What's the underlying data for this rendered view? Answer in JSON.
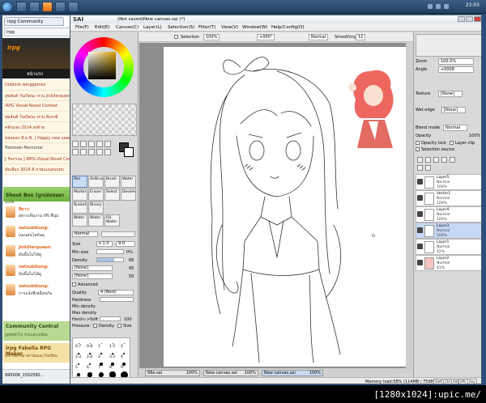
{
  "taskbar": {
    "clock": "23:03"
  },
  "browser": {
    "tab_title": "irpg Community",
    "address": "irpg",
    "logo": "irpg",
    "nav_home": "หน้าแรก",
    "news": [
      "Unblock winggames",
      "สุขสันต์ วันเกิดนะ ท่าน jinkilerqueen",
      "iRPG Visual Novel Contest",
      "สุขสันต์ วันเกิดนะ ท่าน ดีเอกซ์",
      "คลิปแข่ง 2014 ส่งท้าย",
      "หล่อตลก B.o.N. | Happy new year",
      "Tokimeki Memorial",
      "[ กิจกรรม ] iRPG Visual Novel Contest",
      "คัดเลือก 2014 สิ ภาพแบบลบบทบ"
    ],
    "shoutbox_title": "Shout Box (ถูกปล่อยออกมา)",
    "shouts": [
      {
        "name": "สีขาว:",
        "text": "อยากเห็นงาน VN ที่นุ่ม"
      },
      {
        "name": "natsukikung:",
        "text": "เนเนฮนไลจันดุ"
      },
      {
        "name": "jinkillerqueen:",
        "text": "อันนี้นไม่ได้ดู"
      },
      {
        "name": "natsukikung:",
        "text": "อันนี้นไม่ได้ดู"
      },
      {
        "name": "natsukikung:",
        "text": "การแจ้งที่เหมือนกับ"
      }
    ],
    "community_title": "Community Central",
    "community_sub": "พูดคุยทั่วไป ร่วมแลกเปลี่ยน",
    "fabella_title": "irpg Fabella RPG Maker",
    "fabella_sub": "มหาวิทยาลัย สถาบันและโรงเรียน",
    "download": "995006_1502582..."
  },
  "sai": {
    "logo": "SAI",
    "doc_title": "(Not saved)New canvas.sai (*)",
    "menus": [
      "File(F)",
      "Edit(E)",
      "Canvas(C)",
      "Layer(L)",
      "Selection(S)",
      "Filter(T)",
      "View(V)",
      "Window(W)",
      "Help/Config(O)"
    ],
    "options": {
      "selection_label": "Selection",
      "zoom": "100%",
      "angle": "+000°",
      "blend": "Normal",
      "smoothing_label": "Smoothing",
      "smoothing_value": "12"
    },
    "tools": [
      "Pen",
      "AirBrush",
      "Brush",
      "Water",
      "Marker",
      "Eraser",
      "Select",
      "Deselect",
      "Bucket",
      "Binary",
      "Water",
      "Water",
      "Oil Water"
    ],
    "brush": {
      "mode": "Normal",
      "size_label": "Size",
      "size_mult": "x 1.0",
      "size_value": "9.0",
      "minsize_label": "Min size",
      "minsize_value": "0%",
      "density_label": "Density",
      "density_value": "66",
      "texture": "[None]",
      "texture_value": "95",
      "shape": "[None]",
      "shape_value": "50",
      "advanced": "Advanced",
      "quality_label": "Quality",
      "quality_value": "4 (Best)",
      "hardness_label": "Hardness",
      "minden_label": "Min density",
      "maxden_label": "Max density",
      "hardsoft_label": "Hard<->Soft",
      "hardsoft_value": "100",
      "pressure_label": "Pressure:",
      "pressure_density": "Density",
      "pressure_size": "Size"
    },
    "sizes": [
      "0.7",
      "0.8",
      "1",
      "1.5",
      "2",
      "2.3",
      "2.6",
      "3",
      "3.5",
      "4",
      "5",
      "6",
      "7",
      "8",
      "9",
      "10",
      "12",
      "14",
      "16",
      "20"
    ],
    "right": {
      "zoom_label": "Zoom",
      "zoom_value": "100.0%",
      "angle_label": "Angle",
      "angle_value": "+0008",
      "texture_label": "Texture",
      "texture_value": "[None]",
      "wet_edge_label": "Wet edge",
      "wet_edge_value": "[None]",
      "blend_label": "Blend mode",
      "blend_value": "Normal",
      "opacity_label": "Opacity",
      "opacity_value": "100%",
      "opacity_lock": "Opacity lock",
      "layer_clip": "Layer clip",
      "selection_source": "Selection source"
    },
    "layers": [
      {
        "name": "Layer5",
        "mode": "Normal",
        "opacity": "100%"
      },
      {
        "name": "Vector1",
        "mode": "Normal",
        "opacity": "100%"
      },
      {
        "name": "Layer4",
        "mode": "Normal",
        "opacity": "100%"
      },
      {
        "name": "Layer3",
        "mode": "Normal",
        "opacity": "100%"
      },
      {
        "name": "Layer1",
        "mode": "Normal",
        "opacity": "42%"
      },
      {
        "name": "Layer2",
        "mode": "Normal",
        "opacity": "41%"
      }
    ],
    "doc_tabs": [
      {
        "name": "66e.sai",
        "zoom": "100%"
      },
      {
        "name": "New canvas.sai",
        "zoom": "100%"
      },
      {
        "name": "New canvas.sai",
        "zoom": "100%"
      }
    ],
    "memload": "Memory load:58% (114MB / 759MB)",
    "keys": [
      "Shift",
      "Ctrl",
      "Alt",
      "SPC",
      "Any"
    ]
  },
  "watermark": "[1280x1024]:upic.me/"
}
